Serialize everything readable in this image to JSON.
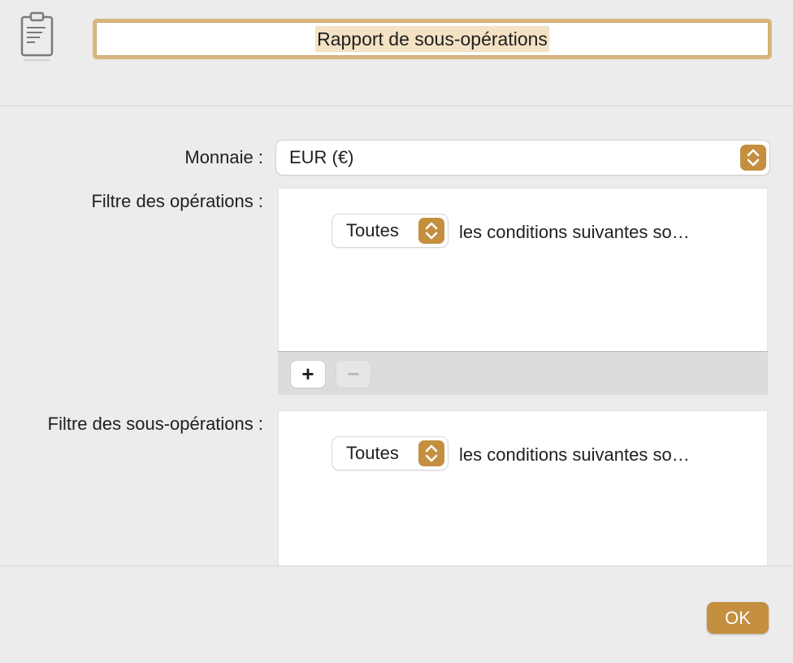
{
  "header": {
    "title": "Rapport de sous-opérations",
    "icon": "clipboard-report-icon"
  },
  "form": {
    "currency_label": "Monnaie :",
    "currency_value": "EUR (€)",
    "transaction_filter_label": "Filtre des opérations :",
    "split_filter_label": "Filtre des sous-opérations :"
  },
  "transaction_filter": {
    "match_value": "Toutes",
    "conditions_text": "les conditions suivantes so…",
    "add_label": "+",
    "remove_label": "−"
  },
  "split_filter": {
    "match_value": "Toutes",
    "conditions_text": "les conditions suivantes so…"
  },
  "footer": {
    "ok_label": "OK"
  },
  "colors": {
    "accent": "#c48f3e",
    "title_highlight": "#f3e2c4",
    "title_border": "#d9b77f"
  }
}
